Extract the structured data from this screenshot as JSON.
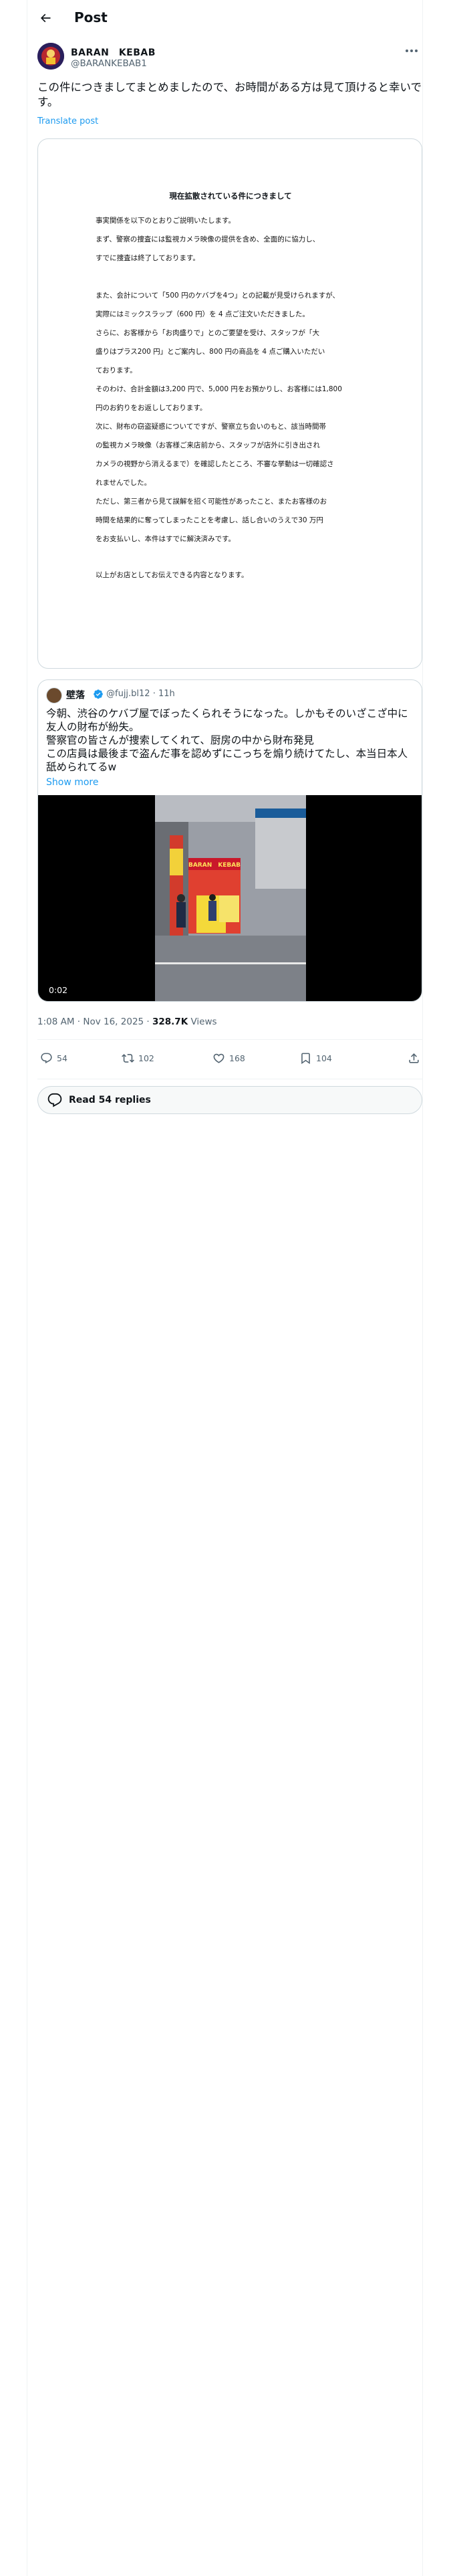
{
  "header": {
    "title": "Post"
  },
  "author": {
    "name": "BARAN　KEBAB",
    "handle": "@BARANKEBAB1"
  },
  "post": {
    "text": "この件につきましてまとめましたので、お時間がある方は見て頂けると幸いです。",
    "translate_label": "Translate post"
  },
  "document": {
    "title": "現在拡散されている件につきまして",
    "lines": [
      "事実関係を以下のとおりご説明いたします。",
      "まず、警察の捜査には監視カメラ映像の提供を含め、全面的に協力し、",
      "すでに捜査は終了しております。",
      "",
      "また、会計について「500 円のケバブを4つ」との記載が見受けられますが、",
      "実際にはミックスラップ（600 円）を 4 点ご注文いただきました。",
      "さらに、お客様から「お肉盛りで」とのご要望を受け、スタッフが「大",
      "盛りはプラス200 円」とご案内し、800 円の商品を 4 点ご購入いただい",
      "ております。",
      "そのわけ、合計金額は3,200 円で、5,000 円をお預かりし、お客様には1,800",
      "円のお釣りをお返ししております。",
      "次に、財布の窃盗疑惑についてですが、警察立ち会いのもと、該当時間帯",
      "の監視カメラ映像（お客様ご来店前から、スタッフが店外に引き出され",
      "カメラの視野から消えるまで）を確認したところ、不審な挙動は一切確認さ",
      "れませんでした。",
      "ただし、第三者から見て誤解を招く可能性があったこと、またお客様のお",
      "時間を結果的に奪ってしまったことを考慮し、話し合いのうえで30 万円",
      "をお支払いし、本件はすでに解決済みです。",
      "",
      "以上がお店としてお伝えできる内容となります。"
    ]
  },
  "quote": {
    "name": "壁落",
    "handle_time": "@fujj.bl12 · 11h",
    "text_lines": [
      "今朝、渋谷のケバブ屋でぼったくられそうになった。しかもそのいざこざ中に友人の財布が紛失。",
      "警察官の皆さんが捜索してくれて、厨房の中から財布発見",
      "この店員は最後まで盗んだ事を認めずにこっちを煽り続けてたし、本当日本人舐められてるw"
    ],
    "show_more": "Show more",
    "video_time": "0:02",
    "sign_text": "BARAN　KEBAB"
  },
  "meta": {
    "time_date": "1:08 AM · Nov 16, 2025 · ",
    "views_count": "328.7K",
    "views_label": " Views"
  },
  "actions": {
    "replies": "54",
    "reposts": "102",
    "likes": "168",
    "bookmarks": "104"
  },
  "read_replies": "Read 54 replies",
  "colors": {
    "accent": "#1d9bf0",
    "text": "#0f1419",
    "muted": "#536471",
    "border": "#cfd9de"
  },
  "icons": [
    "back-arrow-icon",
    "more-icon",
    "verified-icon",
    "reply-icon",
    "repost-icon",
    "like-icon",
    "bookmark-icon",
    "share-icon",
    "replies-bubble-icon"
  ]
}
